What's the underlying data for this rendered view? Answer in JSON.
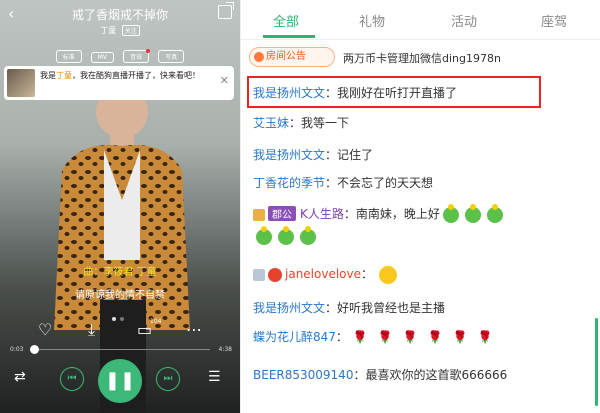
{
  "player": {
    "song_title": "戒了香烟戒不掉你",
    "artist": "丁童",
    "follow": "关注",
    "chips": [
      "标准",
      "MV",
      "音效",
      "写真"
    ],
    "banner": {
      "prefix": "我是",
      "name": "丁童",
      "rest": "，我在酷狗直播开播了，快来看吧！"
    },
    "lyric_composer": "曲：李筱君  丁童",
    "lyric_line": "请原谅我的情不自禁",
    "comment_count": "104",
    "time_current": "0:03",
    "time_total": "4:38",
    "progress": 0.01,
    "icons": {
      "like": "heart-icon",
      "download": "download-icon",
      "comment": "comment-icon",
      "more": "more-icon",
      "loop": "loop-icon",
      "prev": "prev-icon",
      "pause": "pause-icon",
      "next": "next-icon",
      "playlist": "playlist-icon"
    }
  },
  "room": {
    "tabs": [
      "全部",
      "礼物",
      "活动",
      "座驾"
    ],
    "active_tab": "全部",
    "notice_label": "房间公告",
    "notice_text": "两万币卡管理加微信ding1978n",
    "messages": [
      {
        "nick": "我是扬州文文",
        "sep": "：",
        "text": "我刚好在听打开直播了"
      },
      {
        "nick": "艾玉妹",
        "sep": "：",
        "text": "我等一下"
      },
      {
        "nick": "我是扬州文文",
        "sep": "：",
        "text": "记住了"
      },
      {
        "nick": "丁香花的季节",
        "sep": "：",
        "text": "不会忘了的天天想"
      },
      {
        "tag": "郡公",
        "nick": "K人生路",
        "sep": "：",
        "text": "南南妹，晚上好"
      },
      {
        "nick": "janelovelove",
        "sep": "：",
        "text": ""
      },
      {
        "nick": "我是扬州文文",
        "sep": "：",
        "text": "好听我曾经也是主播"
      },
      {
        "nick": "蝶为花儿醉847",
        "sep": "：",
        "text": ""
      },
      {
        "nick": "BEER853009140",
        "sep": "：",
        "text": "最喜欢你的这首歌666666"
      }
    ],
    "colors": {
      "accent": "#2bb673",
      "nick": "#2a77c9",
      "highlight": "#e22222"
    }
  }
}
